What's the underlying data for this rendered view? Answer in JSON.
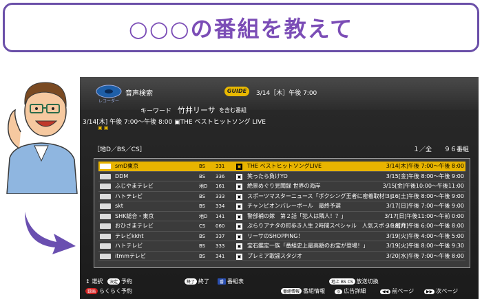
{
  "bubble": {
    "text": "○○○の番組を教えて"
  },
  "screen": {
    "app_title": "音声検索",
    "logo_label": "レコーダー",
    "guide_badge": "GUIDE",
    "datetime": "3/14［木］午後 7:00",
    "keyword_label": "キーワード",
    "keyword_value": "竹井リーサ",
    "keyword_suffix": "を含む番組",
    "selected_info": "3/14[木] 午後 7:00～午後 8:00  ▣THE ベストヒットソング LIVE",
    "category": "［地D／BS／CS］",
    "count": "１／全　　９６番組",
    "rows": [
      {
        "channel": "smD東京",
        "net": "BS",
        "ch": "331",
        "icon": "▣",
        "title": "THE ベストヒットソングLIVE",
        "time": "3/14[木]午後 7:00～午後 8:00",
        "selected": true
      },
      {
        "channel": "DDM",
        "net": "BS",
        "ch": "336",
        "icon": "▣",
        "title": "笑ったら負けYO",
        "time": "3/15[金]午後 8:00～午後 9:00"
      },
      {
        "channel": "ふじやまテレビ",
        "net": "地D",
        "ch": "161",
        "icon": "▣",
        "title": "絶景めぐり見聞録 世界の海岸",
        "time": "3/15[金]午後10:00～午後11:00"
      },
      {
        "channel": "ハトテレビ",
        "net": "BS",
        "ch": "333",
        "icon": "▣",
        "title": "スポーツマスターニュース「ボクシング王者に密着取材！」",
        "time": "3/16[土]午後 8:00～午後 9:00"
      },
      {
        "channel": "skt",
        "net": "BS",
        "ch": "334",
        "icon": "▣",
        "title": "チャンピオンバレーボール　最終予選",
        "time": "3/17[日]午後 7:00～午後 9:00"
      },
      {
        "channel": "SHK総合・東京",
        "net": "地D",
        "ch": "141",
        "icon": "▣",
        "title": "警部補の嫁　第２話「犯人は隣人！？」",
        "time": "3/17[日]午後11:00～午前 0:00"
      },
      {
        "channel": "おひさまテレビ",
        "net": "CS",
        "ch": "060",
        "icon": "▣",
        "title": "ぶらりアナタの町歩き人生 2時間スペシャル　人気スポット紹介！",
        "time": "3/18[月]午後 6:00～午後 8:00"
      },
      {
        "channel": "テレビkkht",
        "net": "BS",
        "ch": "337",
        "icon": "▣",
        "title": "リーサのSHOPPING！",
        "time": "3/19[火]午後 4:00～午後 5:00"
      },
      {
        "channel": "ハトテレビ",
        "net": "BS",
        "ch": "333",
        "icon": "▣",
        "title": "宝石鑑定一族「番組史上最高額のお宝が登場！」",
        "time": "3/19[火]午後 8:00～午後 9:30"
      },
      {
        "channel": "itmmテレビ",
        "net": "BS",
        "ch": "341",
        "icon": "▣",
        "title": "プレミア歌謡スタジオ",
        "time": "3/20[水]午後 7:00～午後 8:00"
      }
    ],
    "footer": {
      "select": "選択",
      "decide_key": "決定",
      "reserve": "予約",
      "end_key": "終了",
      "end": "終了",
      "guide_key": "番",
      "guide": "番組表",
      "switch_keys": "地上 BS CS",
      "switch": "放送切換",
      "easy_key": "録画",
      "easy_reserve": "らくらく予約",
      "info_key": "番組情報",
      "info": "番組情報",
      "ad_key": "◎",
      "ad": "広告詳細",
      "prev_key": "◀◀",
      "prev": "前ページ",
      "next_key": "▶▶",
      "next": "次ページ"
    }
  },
  "colors": {
    "bubble_border": "#6a4fa8",
    "bubble_text": "#7b4db6",
    "selected_row": "#e8b400",
    "arrow": "#6a4fb0"
  }
}
